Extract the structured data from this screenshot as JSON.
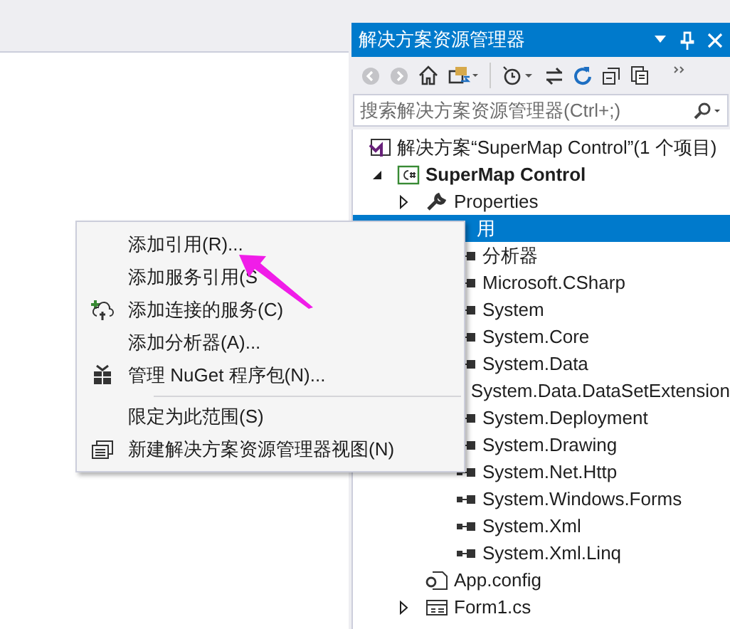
{
  "solution_explorer": {
    "title": "解决方案资源管理器",
    "search": {
      "placeholder": "搜索解决方案资源管理器(Ctrl+;)"
    },
    "tree": [
      {
        "label": "解决方案“SuperMap Control”(1 个项目)",
        "kind": "solution",
        "selected": false,
        "children": [
          {
            "label": "SuperMap Control",
            "kind": "project",
            "expanded": true,
            "selected": false,
            "children": [
              {
                "label": "Properties",
                "kind": "properties",
                "expanded": false,
                "selected": false
              },
              {
                "label": "用",
                "kind": "references",
                "expanded": true,
                "selected": true,
                "children": [
                  {
                    "label": "分析器",
                    "selected": false
                  },
                  {
                    "label": "Microsoft.CSharp",
                    "selected": false
                  },
                  {
                    "label": "System",
                    "selected": false
                  },
                  {
                    "label": "System.Core",
                    "selected": false
                  },
                  {
                    "label": "System.Data",
                    "selected": false
                  },
                  {
                    "label": "System.Data.DataSetExtension",
                    "selected": false
                  },
                  {
                    "label": "System.Deployment",
                    "selected": false
                  },
                  {
                    "label": "System.Drawing",
                    "selected": false
                  },
                  {
                    "label": "System.Net.Http",
                    "selected": false
                  },
                  {
                    "label": "System.Windows.Forms",
                    "selected": false
                  },
                  {
                    "label": "System.Xml",
                    "selected": false
                  },
                  {
                    "label": "System.Xml.Linq",
                    "selected": false
                  }
                ]
              },
              {
                "label": "App.config",
                "kind": "config",
                "selected": false
              },
              {
                "label": "Form1.cs",
                "kind": "form",
                "expanded": false,
                "selected": false
              }
            ]
          }
        ]
      }
    ]
  },
  "context_menu": {
    "items": [
      {
        "kind": "item",
        "label": "添加引用(R)..."
      },
      {
        "kind": "item",
        "label": "添加服务引用(S"
      },
      {
        "kind": "item",
        "label": "添加连接的服务(C)"
      },
      {
        "kind": "item",
        "label": "添加分析器(A)..."
      },
      {
        "kind": "item",
        "label": "管理 NuGet 程序包(N)..."
      },
      {
        "kind": "separator"
      },
      {
        "kind": "item",
        "label": "限定为此范围(S)"
      },
      {
        "kind": "item",
        "label": "新建解决方案资源管理器视图(N)"
      }
    ]
  }
}
